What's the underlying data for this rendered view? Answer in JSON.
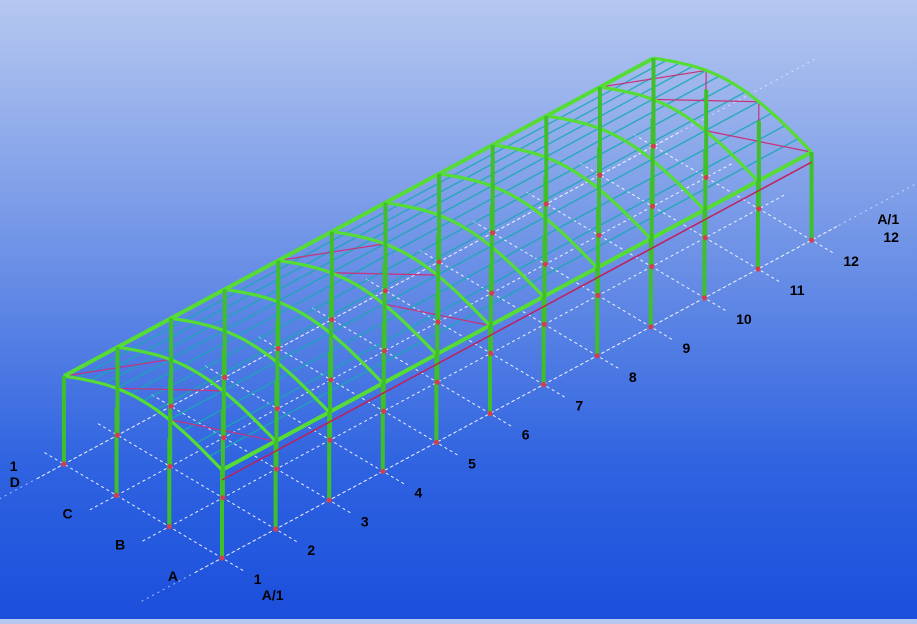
{
  "row_labels": [
    "A",
    "B",
    "C",
    "D"
  ],
  "row_label_extra": "1",
  "axis_labels": [
    "1",
    "2",
    "3",
    "4",
    "5",
    "6",
    "7",
    "8",
    "9",
    "10",
    "11",
    "12"
  ],
  "corner_labels": [
    "A/1",
    "A/1"
  ],
  "corner_number": "12",
  "colors": {
    "grid_line": "#ffffff",
    "column": "#3fc02a",
    "rafter": "#55dd35",
    "purlin": "#17a9b5",
    "bracing": "#c8327a",
    "tie_beam": "#c01f5a",
    "base_node": "#d04050",
    "label": "#000000"
  }
}
